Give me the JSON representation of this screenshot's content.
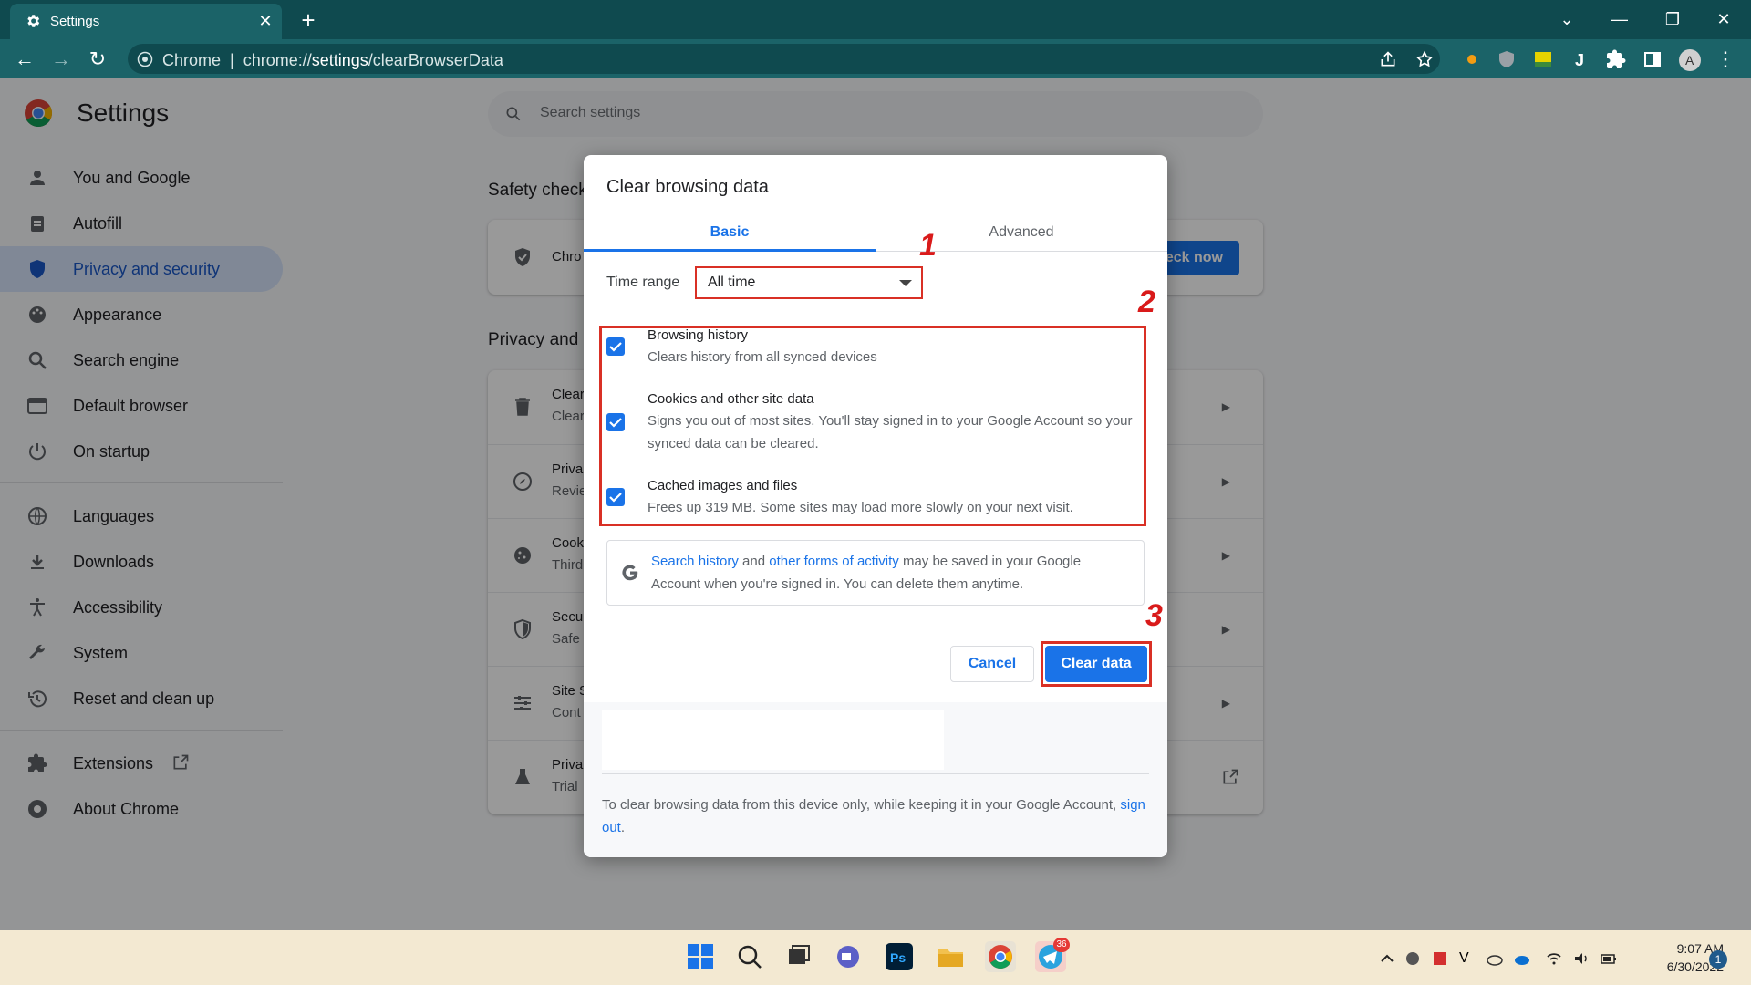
{
  "browser": {
    "tab_title": "Settings",
    "url_host": "Chrome",
    "url_prefix": "chrome://",
    "url_path_bold": "settings",
    "url_rest": "/clearBrowserData"
  },
  "settings": {
    "title": "Settings",
    "search_placeholder": "Search settings",
    "nav": [
      {
        "label": "You and Google",
        "icon": "person-icon"
      },
      {
        "label": "Autofill",
        "icon": "clipboard-icon"
      },
      {
        "label": "Privacy and security",
        "icon": "shield-icon",
        "active": true
      },
      {
        "label": "Appearance",
        "icon": "palette-icon"
      },
      {
        "label": "Search engine",
        "icon": "search-icon"
      },
      {
        "label": "Default browser",
        "icon": "browser-icon"
      },
      {
        "label": "On startup",
        "icon": "power-icon"
      },
      {
        "label": "Languages",
        "icon": "globe-icon"
      },
      {
        "label": "Downloads",
        "icon": "download-icon"
      },
      {
        "label": "Accessibility",
        "icon": "accessibility-icon"
      },
      {
        "label": "System",
        "icon": "wrench-icon"
      },
      {
        "label": "Reset and clean up",
        "icon": "restore-icon"
      },
      {
        "label": "Extensions",
        "icon": "puzzle-icon"
      },
      {
        "label": "About Chrome",
        "icon": "chrome-icon"
      }
    ],
    "safety_check_title": "Safety check",
    "safety_row_title": "Chro",
    "check_now": "eck now",
    "privacy_title": "Privacy and s",
    "privacy_rows": [
      {
        "title": "Clear",
        "sub": "Clear",
        "icon": "trash-icon"
      },
      {
        "title": "Priva",
        "sub": "Revie",
        "icon": "compass-icon"
      },
      {
        "title": "Cook",
        "sub": "Third",
        "icon": "cookie-icon"
      },
      {
        "title": "Secu",
        "sub": "Safe",
        "icon": "shield-icon"
      },
      {
        "title": "Site S",
        "sub": "Cont",
        "icon": "sliders-icon"
      },
      {
        "title": "Priva",
        "sub": "Trial",
        "icon": "flask-icon"
      }
    ]
  },
  "dialog": {
    "title": "Clear browsing data",
    "tab_basic": "Basic",
    "tab_advanced": "Advanced",
    "time_range_label": "Time range",
    "time_range_value": "All time",
    "items": [
      {
        "title": "Browsing history",
        "desc": "Clears history from all synced devices",
        "checked": true
      },
      {
        "title": "Cookies and other site data",
        "desc": "Signs you out of most sites. You'll stay signed in to your Google Account so your synced data can be cleared.",
        "checked": true
      },
      {
        "title": "Cached images and files",
        "desc": "Frees up 319 MB. Some sites may load more slowly on your next visit.",
        "checked": true
      }
    ],
    "google_note": {
      "link1": "Search history",
      "and": " and ",
      "link2": "other forms of activity",
      "rest": " may be saved in your Google Account when you're signed in. You can delete them anytime."
    },
    "cancel": "Cancel",
    "clear": "Clear data",
    "footer_text": "To clear browsing data from this device only, while keeping it in your Google Account, ",
    "footer_link": "sign out",
    "footer_end": "."
  },
  "annotations": {
    "n1": "1",
    "n2": "2",
    "n3": "3",
    "color": "#d93025"
  },
  "taskbar": {
    "time": "9:07 AM",
    "date": "6/30/2022",
    "notifications": "1",
    "telegram_badge": "36"
  }
}
